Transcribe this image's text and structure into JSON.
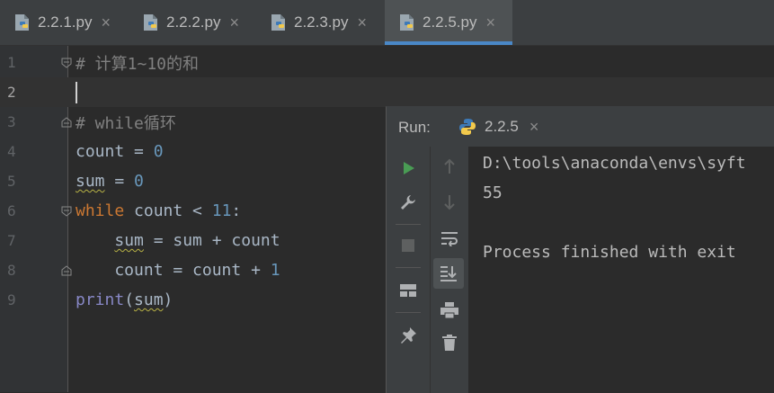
{
  "tabs": [
    {
      "label": "2.2.1.py",
      "active": false
    },
    {
      "label": "2.2.2.py",
      "active": false
    },
    {
      "label": "2.2.3.py",
      "active": false
    },
    {
      "label": "2.2.5.py",
      "active": true
    }
  ],
  "editor": {
    "line_numbers": [
      "1",
      "2",
      "3",
      "4",
      "5",
      "6",
      "7",
      "8",
      "9"
    ],
    "current_line": 2,
    "lines": {
      "l1_comment": "# 计算1~10的和",
      "l3_comment": "# while循环",
      "l4_var": "count",
      "l4_op": " = ",
      "l4_num": "0",
      "l5_var": "sum",
      "l5_op": " = ",
      "l5_num": "0",
      "l6_kw": "while",
      "l6_rest": " count < ",
      "l6_num": "11",
      "l6_colon": ":",
      "l7_indent": "    ",
      "l7_var": "sum",
      "l7_rest": " = sum + count",
      "l8_code": "    count = count + ",
      "l8_num": "1",
      "l9_fn": "print",
      "l9_open": "(",
      "l9_arg": "sum",
      "l9_close": ")"
    }
  },
  "run_panel": {
    "label": "Run:",
    "tab_label": "2.2.5",
    "console": [
      "D:\\tools\\anaconda\\envs\\syft",
      "55",
      "",
      "Process finished with exit"
    ],
    "colors": {
      "run_green": "#499c54"
    }
  },
  "icons": {
    "file": "python-file-icon",
    "close": "×",
    "toolbar_left": [
      "run-icon",
      "wrench-icon",
      "stop-icon",
      "layout-icon",
      "pin-icon"
    ],
    "toolbar_right": [
      "arrow-up-icon",
      "arrow-down-icon",
      "soft-wrap-icon",
      "scroll-to-end-icon",
      "print-icon",
      "trash-icon"
    ]
  }
}
